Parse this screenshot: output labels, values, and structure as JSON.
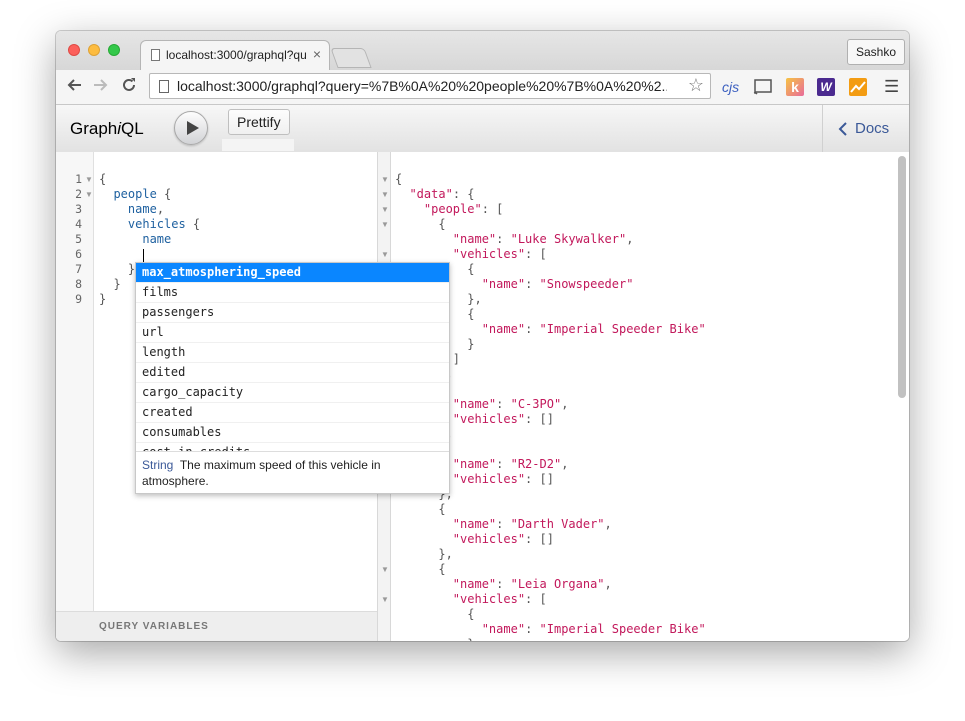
{
  "browser": {
    "tab_title": "localhost:3000/graphql?qu",
    "tab_close": "×",
    "profile": "Sashko",
    "url": "localhost:3000/graphql?query=%7B%0A%20%20people%20%7B%0A%20%2...",
    "extensions": [
      "cjs",
      "k",
      "W",
      "chart"
    ]
  },
  "graphiql": {
    "logo_prefix": "Graph",
    "logo_i": "i",
    "logo_suffix": "QL",
    "prettify_label": "Prettify",
    "docs_label": "Docs",
    "query_variables_label": "QUERY VARIABLES"
  },
  "editor": {
    "line_numbers": [
      "1",
      "2",
      "3",
      "4",
      "5",
      "6",
      "7",
      "8",
      "9"
    ],
    "lines": [
      {
        "indent": "",
        "parts": [
          {
            "t": "{",
            "c": "p"
          }
        ]
      },
      {
        "indent": "  ",
        "parts": [
          {
            "t": "people",
            "c": "kw"
          },
          {
            "t": " {",
            "c": "p"
          }
        ]
      },
      {
        "indent": "    ",
        "parts": [
          {
            "t": "name",
            "c": "kw"
          },
          {
            "t": ",",
            "c": "p"
          }
        ]
      },
      {
        "indent": "    ",
        "parts": [
          {
            "t": "vehicles",
            "c": "kw"
          },
          {
            "t": " {",
            "c": "p"
          }
        ]
      },
      {
        "indent": "      ",
        "parts": [
          {
            "t": "name",
            "c": "kw"
          }
        ]
      },
      {
        "indent": "",
        "parts": []
      },
      {
        "indent": "    ",
        "parts": [
          {
            "t": "}",
            "c": "p"
          }
        ]
      },
      {
        "indent": "  ",
        "parts": [
          {
            "t": "}",
            "c": "p"
          }
        ]
      },
      {
        "indent": "",
        "parts": [
          {
            "t": "}",
            "c": "p"
          }
        ]
      }
    ]
  },
  "autocomplete": {
    "items": [
      "max_atmosphering_speed",
      "films",
      "passengers",
      "url",
      "length",
      "edited",
      "cargo_capacity",
      "created",
      "consumables",
      "cost_in_credits"
    ],
    "selected_index": 0,
    "description_type": "String",
    "description_text": "The maximum speed of this vehicle in atmosphere."
  },
  "result": {
    "lines": [
      {
        "indent": "",
        "parts": [
          {
            "t": "{",
            "c": "p"
          }
        ]
      },
      {
        "indent": "  ",
        "parts": [
          {
            "t": "\"data\"",
            "c": "k"
          },
          {
            "t": ": {",
            "c": "p"
          }
        ]
      },
      {
        "indent": "    ",
        "parts": [
          {
            "t": "\"people\"",
            "c": "k"
          },
          {
            "t": ": [",
            "c": "p"
          }
        ]
      },
      {
        "indent": "      ",
        "parts": [
          {
            "t": "{",
            "c": "p"
          }
        ]
      },
      {
        "indent": "        ",
        "parts": [
          {
            "t": "\"name\"",
            "c": "k"
          },
          {
            "t": ": ",
            "c": "p"
          },
          {
            "t": "\"Luke Skywalker\"",
            "c": "s"
          },
          {
            "t": ",",
            "c": "p"
          }
        ]
      },
      {
        "indent": "        ",
        "parts": [
          {
            "t": "\"vehicles\"",
            "c": "k"
          },
          {
            "t": ": [",
            "c": "p"
          }
        ]
      },
      {
        "indent": "          ",
        "parts": [
          {
            "t": "{",
            "c": "p"
          }
        ]
      },
      {
        "indent": "            ",
        "parts": [
          {
            "t": "\"name\"",
            "c": "k"
          },
          {
            "t": ": ",
            "c": "p"
          },
          {
            "t": "\"Snowspeeder\"",
            "c": "s"
          }
        ]
      },
      {
        "indent": "          ",
        "parts": [
          {
            "t": "},",
            "c": "p"
          }
        ]
      },
      {
        "indent": "          ",
        "parts": [
          {
            "t": "{",
            "c": "p"
          }
        ]
      },
      {
        "indent": "            ",
        "parts": [
          {
            "t": "\"name\"",
            "c": "k"
          },
          {
            "t": ": ",
            "c": "p"
          },
          {
            "t": "\"Imperial Speeder Bike\"",
            "c": "s"
          }
        ]
      },
      {
        "indent": "          ",
        "parts": [
          {
            "t": "}",
            "c": "p"
          }
        ]
      },
      {
        "indent": "        ",
        "parts": [
          {
            "t": "]",
            "c": "p"
          }
        ]
      },
      {
        "indent": "      ",
        "parts": [
          {
            "t": "},",
            "c": "p"
          }
        ]
      },
      {
        "indent": "      ",
        "parts": [
          {
            "t": "{",
            "c": "p"
          }
        ]
      },
      {
        "indent": "        ",
        "parts": [
          {
            "t": "\"name\"",
            "c": "k"
          },
          {
            "t": ": ",
            "c": "p"
          },
          {
            "t": "\"C-3PO\"",
            "c": "s"
          },
          {
            "t": ",",
            "c": "p"
          }
        ]
      },
      {
        "indent": "        ",
        "parts": [
          {
            "t": "\"vehicles\"",
            "c": "k"
          },
          {
            "t": ": []",
            "c": "p"
          }
        ]
      },
      {
        "indent": "      ",
        "parts": [
          {
            "t": "},",
            "c": "p"
          }
        ]
      },
      {
        "indent": "      ",
        "parts": [
          {
            "t": "{",
            "c": "p"
          }
        ]
      },
      {
        "indent": "        ",
        "parts": [
          {
            "t": "\"name\"",
            "c": "k"
          },
          {
            "t": ": ",
            "c": "p"
          },
          {
            "t": "\"R2-D2\"",
            "c": "s"
          },
          {
            "t": ",",
            "c": "p"
          }
        ]
      },
      {
        "indent": "        ",
        "parts": [
          {
            "t": "\"vehicles\"",
            "c": "k"
          },
          {
            "t": ": []",
            "c": "p"
          }
        ]
      },
      {
        "indent": "      ",
        "parts": [
          {
            "t": "},",
            "c": "p"
          }
        ]
      },
      {
        "indent": "      ",
        "parts": [
          {
            "t": "{",
            "c": "p"
          }
        ]
      },
      {
        "indent": "        ",
        "parts": [
          {
            "t": "\"name\"",
            "c": "k"
          },
          {
            "t": ": ",
            "c": "p"
          },
          {
            "t": "\"Darth Vader\"",
            "c": "s"
          },
          {
            "t": ",",
            "c": "p"
          }
        ]
      },
      {
        "indent": "        ",
        "parts": [
          {
            "t": "\"vehicles\"",
            "c": "k"
          },
          {
            "t": ": []",
            "c": "p"
          }
        ]
      },
      {
        "indent": "      ",
        "parts": [
          {
            "t": "},",
            "c": "p"
          }
        ]
      },
      {
        "indent": "      ",
        "parts": [
          {
            "t": "{",
            "c": "p"
          }
        ]
      },
      {
        "indent": "        ",
        "parts": [
          {
            "t": "\"name\"",
            "c": "k"
          },
          {
            "t": ": ",
            "c": "p"
          },
          {
            "t": "\"Leia Organa\"",
            "c": "s"
          },
          {
            "t": ",",
            "c": "p"
          }
        ]
      },
      {
        "indent": "        ",
        "parts": [
          {
            "t": "\"vehicles\"",
            "c": "k"
          },
          {
            "t": ": [",
            "c": "p"
          }
        ]
      },
      {
        "indent": "          ",
        "parts": [
          {
            "t": "{",
            "c": "p"
          }
        ]
      },
      {
        "indent": "            ",
        "parts": [
          {
            "t": "\"name\"",
            "c": "k"
          },
          {
            "t": ": ",
            "c": "p"
          },
          {
            "t": "\"Imperial Speeder Bike\"",
            "c": "s"
          }
        ]
      },
      {
        "indent": "          ",
        "parts": [
          {
            "t": "}",
            "c": "p"
          }
        ]
      }
    ]
  },
  "colors": {
    "accent": "#0a86ff",
    "keyword": "#1f61a0",
    "json_string": "#c2185b",
    "docs_link": "#3b5998"
  }
}
